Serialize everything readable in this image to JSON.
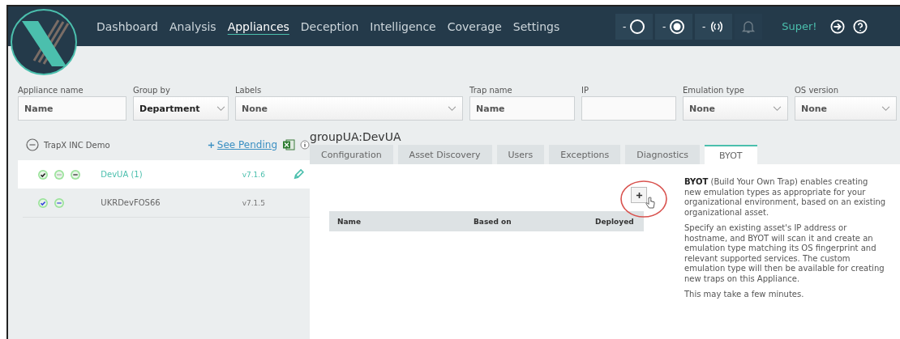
{
  "nav": [
    {
      "label": "Dashboard",
      "selected": false
    },
    {
      "label": "Analysis",
      "selected": false
    },
    {
      "label": "Appliances",
      "selected": true
    },
    {
      "label": "Deception",
      "selected": false
    },
    {
      "label": "Intelligence",
      "selected": false
    },
    {
      "label": "Coverage",
      "selected": false
    },
    {
      "label": "Settings",
      "selected": false
    }
  ],
  "status_buttons": [
    {
      "label": "-",
      "kind": "ring",
      "disabled": false
    },
    {
      "label": "-",
      "kind": "target",
      "disabled": false
    },
    {
      "label": "-",
      "kind": "signal",
      "disabled": false
    },
    {
      "kind": "bell",
      "disabled": true
    }
  ],
  "user": "Super!",
  "filters": [
    {
      "label": "Appliance name",
      "value": "Name",
      "kind": "input"
    },
    {
      "label": "Group by",
      "value": "Department",
      "kind": "select"
    },
    {
      "label": "Labels",
      "value": "None",
      "kind": "select"
    },
    {
      "label": "Trap name",
      "value": "Name",
      "kind": "input"
    },
    {
      "label": "IP",
      "kind": "input"
    },
    {
      "label": "Emulation type",
      "value": "None",
      "kind": "select"
    },
    {
      "label": "OS version",
      "value": "None",
      "kind": "select"
    }
  ],
  "tree": {
    "label": "TrapX INC Demo",
    "expanded": true,
    "pending_link": "See Pending",
    "children": [
      {
        "name": "DevUA",
        "count": "(1)",
        "version": "v7.1.6",
        "selected": true,
        "statuses": [
          {
            "kind": "check"
          },
          {
            "kind": "dots"
          },
          {
            "kind": "minus"
          }
        ]
      },
      {
        "name": "UKRDevFOS66",
        "version": "v7.1.5",
        "selected": false,
        "statuses": [
          {
            "kind": "check"
          },
          {
            "kind": "minus"
          }
        ]
      }
    ]
  },
  "group_title": "groupUA:DevUA",
  "tabs": [
    {
      "label": "Configuration",
      "selected": false
    },
    {
      "label": "Asset Discovery",
      "selected": false
    },
    {
      "label": "Users",
      "selected": false
    },
    {
      "label": "Exceptions",
      "selected": false
    },
    {
      "label": "Diagnostics",
      "selected": false
    },
    {
      "label": "BYOT",
      "selected": true
    }
  ],
  "table": {
    "columns": [
      "Name",
      "Based on",
      "Deployed"
    ]
  },
  "help": [
    "**BYOT** (Build Your Own Trap) enables creating new emulation types as appropriate for your organizational environment, based on an existing organizational asset.",
    "Specify an existing asset's IP address or hostname, and BYOT will scan it and create an emulation type matching its OS fingerprint and relevant supported services. The custom emulation type will then be available for creating new traps on this Appliance.",
    "This may take a few minutes."
  ]
}
